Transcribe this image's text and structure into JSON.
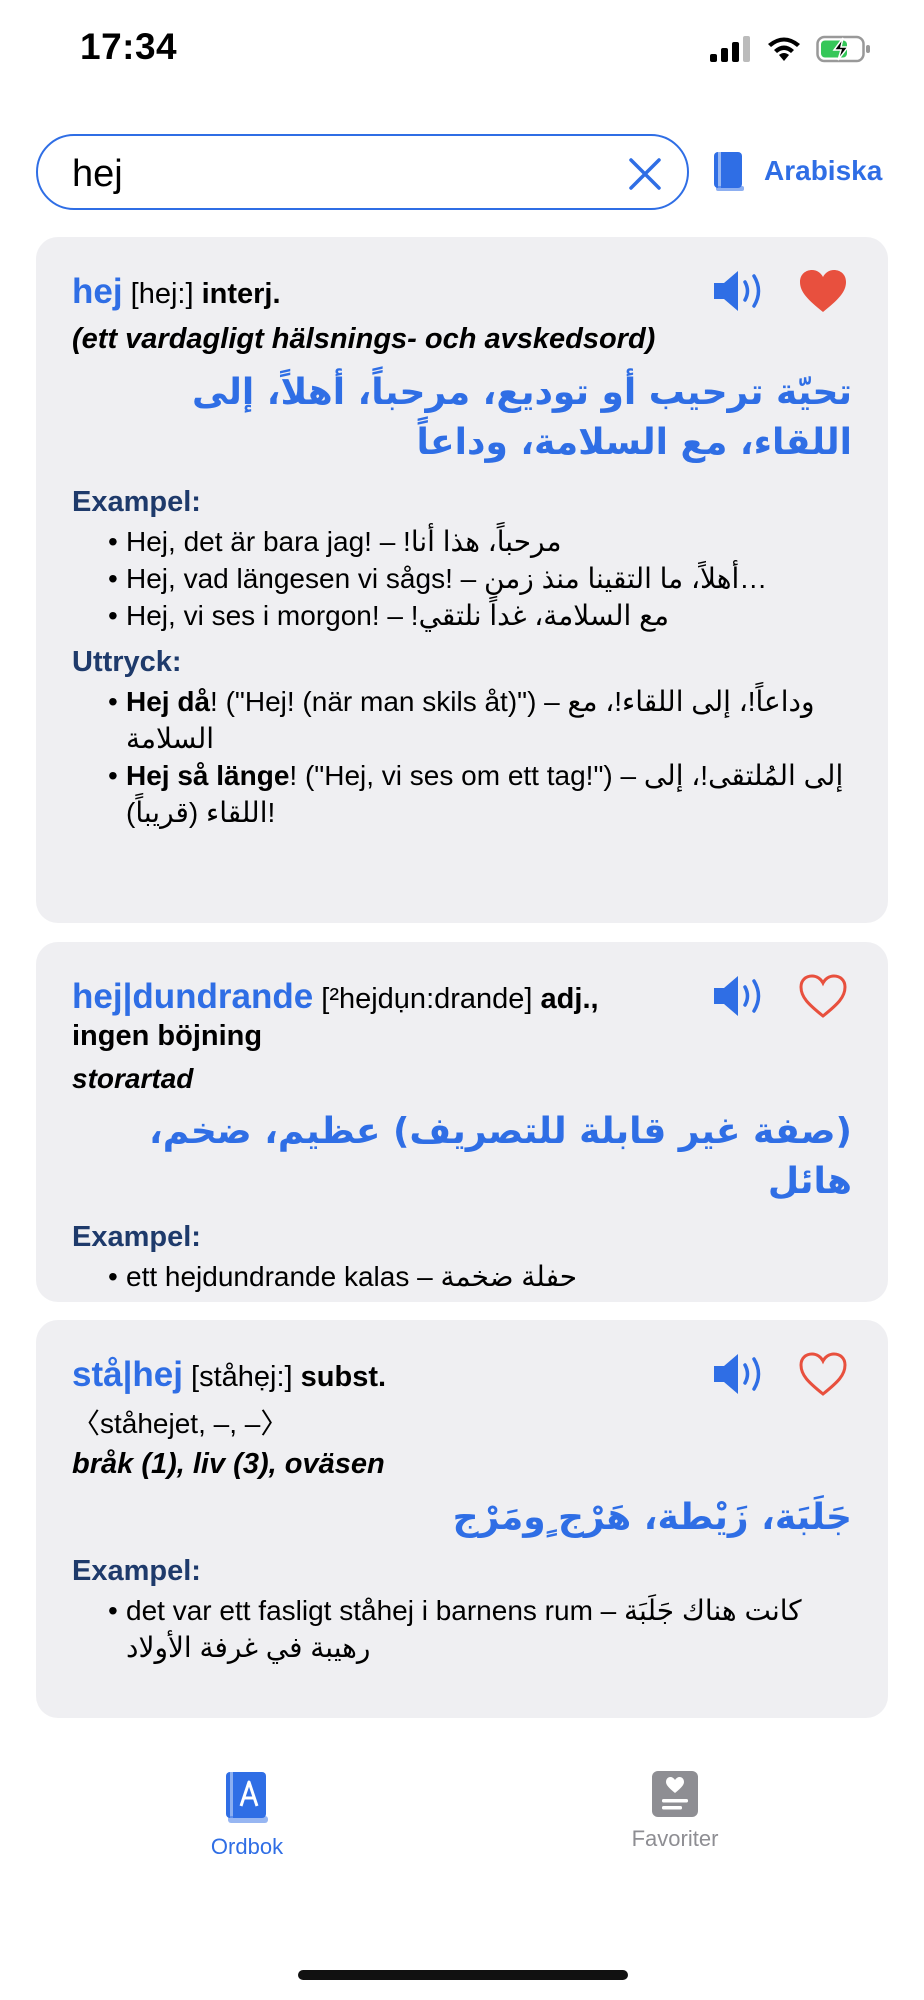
{
  "status": {
    "time": "17:34"
  },
  "search": {
    "value": "hej",
    "placeholder": ""
  },
  "language": {
    "label": "Arabiska"
  },
  "entries": [
    {
      "headword": "hej",
      "pronunciation": "[hej:]",
      "pos": "interj.",
      "gloss": "(ett vardagligt hälsnings- och avskedsord)",
      "translation": "تحيّة ترحيب أو توديع، مرحباً، أهلاً، إلى اللقاء، مع السلامة، وداعاً",
      "favorite": true,
      "examples_title": "Exampel:",
      "examples": [
        "Hej, det är bara jag! – !مرحباً، هذا أنا",
        "Hej, vad längesen vi sågs! – أهلاً، ما التقينا منذ زمن…",
        "Hej, vi ses i morgon! – !مع السلامة، غداً نلتقي"
      ],
      "idioms_title": "Uttryck:",
      "idioms": [
        {
          "term": "Hej då",
          "rest": "! (\"Hej! (när man skils åt)\") – وداعاً!، إلى اللقاء!، مع السلامة"
        },
        {
          "term": "Hej så länge",
          "rest": "! (\"Hej, vi ses om ett tag!\") – إلى المُلتقى!، إلى اللقاء (قريباً)!"
        }
      ]
    },
    {
      "headword": "hej|dundrande",
      "pronunciation": "[²hejdụn:drande]",
      "pos": "adj.,",
      "pos_extra": "ingen böjning",
      "gloss": "storartad",
      "translation": "(صفة غير قابلة للتصريف) عظيم، ضخم، هائل",
      "favorite": false,
      "examples_title": "Exampel:",
      "examples": [
        "ett hejdundrande kalas – حفلة ضخمة"
      ]
    },
    {
      "headword": "stå|hej",
      "pronunciation": "[ståhẹj:]",
      "pos": "subst.",
      "inflection": "〈ståhejet, –, –〉",
      "gloss": "bråk (1), liv (3), oväsen",
      "translation": "جَلَبَة، زَيْطة، هَرْج ٍومَرْج",
      "favorite": false,
      "examples_title": "Exampel:",
      "examples": [
        "det var ett fasligt ståhej i barnens rum – كانت هناك جَلَبَة رهيبة في غرفة الأولاد"
      ]
    }
  ],
  "tabs": [
    {
      "label": "Ordbok",
      "active": true
    },
    {
      "label": "Favoriter",
      "active": false
    }
  ],
  "colors": {
    "accent": "#2f6ee5",
    "heart": "#e8503e",
    "card": "#efeff2",
    "inactive": "#8e8e93"
  }
}
